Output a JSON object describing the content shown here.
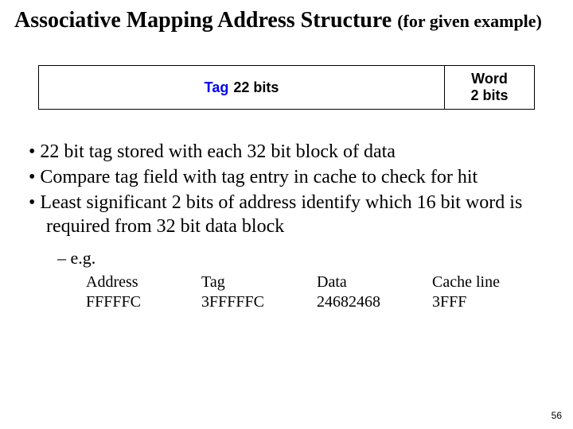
{
  "title": {
    "main": "Associative Mapping Address Structure ",
    "sub": "(for given example)"
  },
  "addr": {
    "tag_label": "Tag",
    "tag_bits": "22 bits",
    "word_label": "Word",
    "word_bits": "2 bits"
  },
  "bullets": [
    "22 bit tag stored with each 32 bit block of data",
    "Compare tag field with tag entry in cache to check for hit",
    "Least significant 2 bits of address identify which 16 bit word is required from 32 bit data block"
  ],
  "subbullet": "e.g.",
  "example": {
    "headers": [
      "Address",
      "Tag",
      "Data",
      "Cache line"
    ],
    "row": [
      "FFFFFC",
      "3FFFFFC",
      "24682468",
      "3FFF"
    ]
  },
  "page_number": "56"
}
